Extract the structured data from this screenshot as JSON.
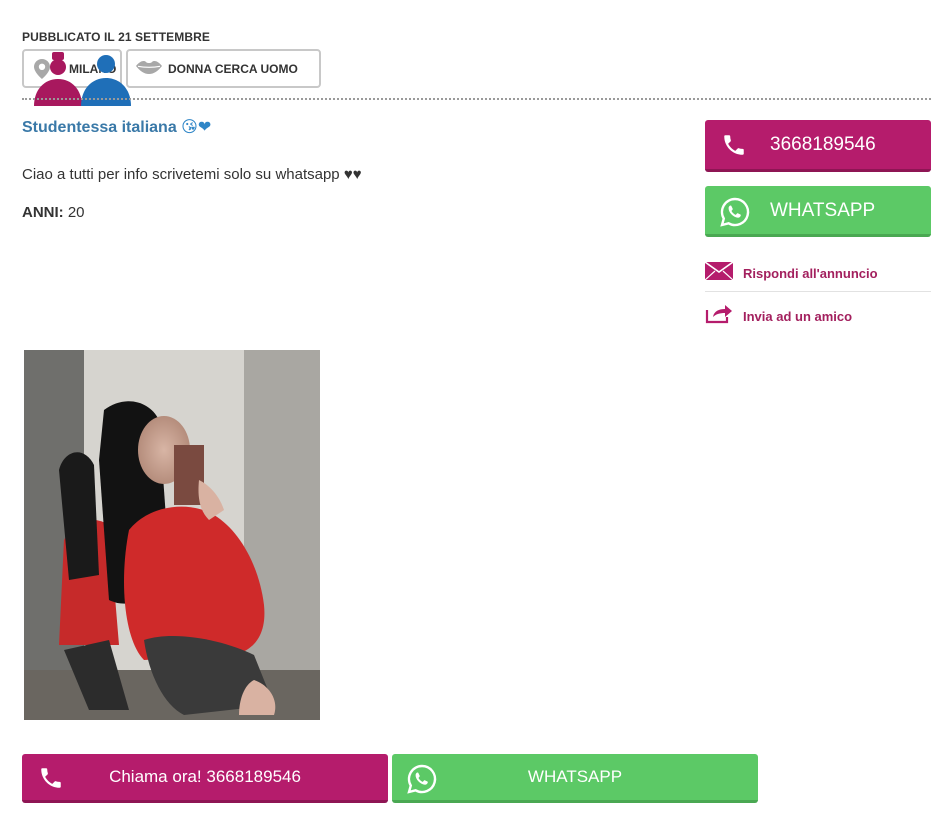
{
  "header": {
    "published": "PUBBLICATO IL 21 SETTEMBRE",
    "city_tag": "MILANO",
    "category_tag": "DONNA CERCA UOMO"
  },
  "ad": {
    "title": "Studentessa italiana",
    "title_emoji": "😘❤",
    "description": "Ciao a tutti per info scrivetemi solo su whatsapp ♥♥",
    "age_label": "ANNI:",
    "age_value": "20"
  },
  "sidebar": {
    "phone_label": "3668189546",
    "whatsapp_label": "WHATSAPP",
    "reply_label": "Rispondi all'annuncio",
    "share_label": "Invia ad un amico"
  },
  "footer": {
    "call_label": "Chiama ora! 3668189546",
    "whatsapp_label": "WHATSAPP"
  },
  "colors": {
    "brand_magenta": "#b51c6c",
    "whatsapp_green": "#5cc966",
    "title_blue": "#3a79a8"
  },
  "icons": {
    "pin": "map-pin-icon",
    "lips": "lips-icon",
    "phone": "phone-icon",
    "whatsapp": "whatsapp-icon",
    "mail": "mail-icon",
    "share": "share-icon"
  }
}
